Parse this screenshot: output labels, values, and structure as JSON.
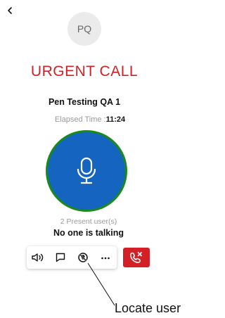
{
  "header": {
    "back_icon": "chevron-left-icon"
  },
  "contact": {
    "avatar_initials": "PQ"
  },
  "call": {
    "status_title": "URGENT CALL",
    "channel_name": "Pen Testing QA 1",
    "elapsed_label": "Elapsed Time :",
    "elapsed_time": "11:24",
    "present_users": "2 Present user(s)",
    "talk_status": "No one is talking"
  },
  "toolbar": {
    "buttons": [
      {
        "icon": "speaker-icon",
        "name": "speaker-button"
      },
      {
        "icon": "message-icon",
        "name": "message-button"
      },
      {
        "icon": "locate-user-icon",
        "name": "locate-user-button"
      },
      {
        "icon": "more-icon",
        "name": "more-button"
      }
    ],
    "end_call_icon": "end-call-icon"
  },
  "annotation": {
    "label": "Locate user"
  },
  "colors": {
    "urgent_red": "#d32027",
    "ptt_blue": "#1565c0",
    "ptt_ring_green": "#1a8a1a"
  }
}
